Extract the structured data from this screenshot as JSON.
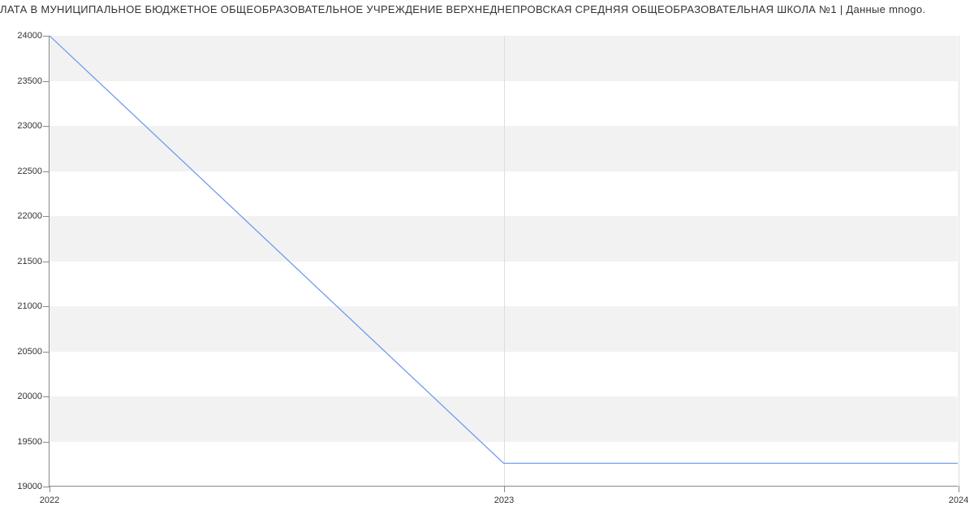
{
  "title": "ЛАТА В МУНИЦИПАЛЬНОЕ БЮДЖЕТНОЕ ОБЩЕОБРАЗОВАТЕЛЬНОЕ УЧРЕЖДЕНИЕ ВЕРХНЕДНЕПРОВСКАЯ СРЕДНЯЯ ОБЩЕОБРАЗОВАТЕЛЬНАЯ ШКОЛА №1 | Данные mnogo.",
  "chart_data": {
    "type": "line",
    "x": [
      2022,
      2023,
      2024
    ],
    "values": [
      24000,
      19250,
      19250
    ],
    "xlabel": "",
    "ylabel": "",
    "xlim": [
      2022,
      2024
    ],
    "ylim": [
      19000,
      24000
    ],
    "y_ticks": [
      19000,
      19500,
      20000,
      20500,
      21000,
      21500,
      22000,
      22500,
      23000,
      23500,
      24000
    ],
    "x_ticks": [
      2022,
      2023,
      2024
    ]
  }
}
